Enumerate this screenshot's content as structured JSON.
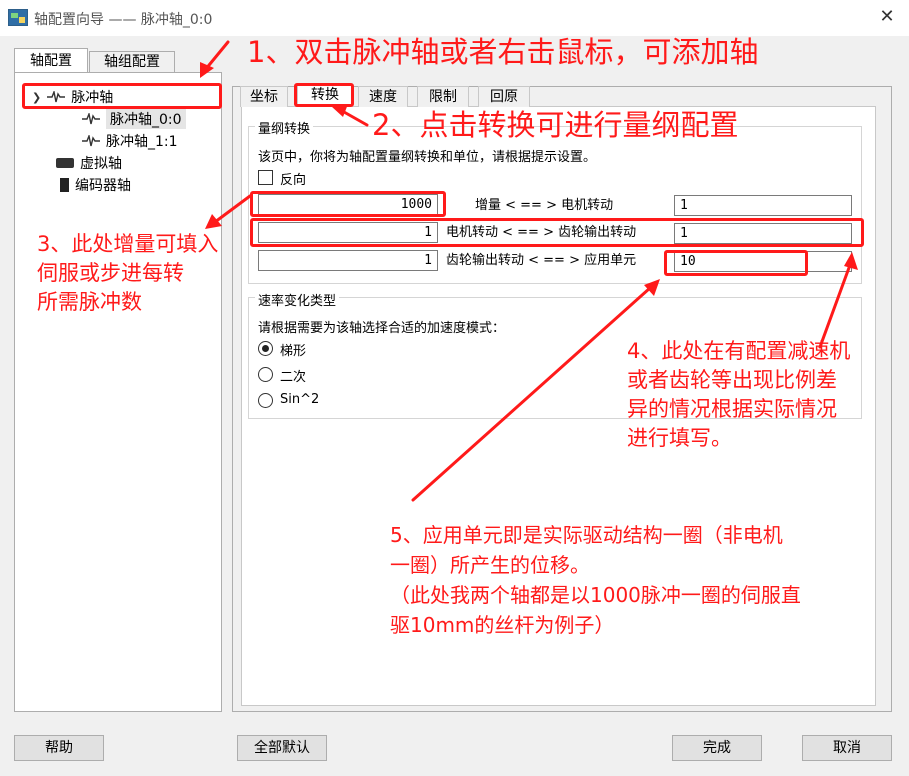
{
  "window": {
    "title": "轴配置向导 —— 脉冲轴_0:0",
    "close_glyph": "✕"
  },
  "top_tabs": [
    {
      "label": "轴配置",
      "active": true
    },
    {
      "label": "轴组配置",
      "active": false
    }
  ],
  "tree": {
    "root": {
      "label": "脉冲轴",
      "expanded": true
    },
    "children": [
      {
        "label": "脉冲轴_0:0",
        "selected": true
      },
      {
        "label": "脉冲轴_1:1",
        "selected": false
      }
    ],
    "others": [
      {
        "label": "虚拟轴",
        "icon": "virtual-axis-icon"
      },
      {
        "label": "编码器轴",
        "icon": "encoder-axis-icon"
      }
    ]
  },
  "inner_tabs": [
    {
      "label": "坐标",
      "active": false
    },
    {
      "label": "转换",
      "active": true
    },
    {
      "label": "速度",
      "active": false
    },
    {
      "label": "限制",
      "active": false
    },
    {
      "label": "回原",
      "active": false
    }
  ],
  "scaling": {
    "group_title": "量纲转换",
    "description": "该页中，你将为轴配置量纲转换和单位，请根据提示设置。",
    "reverse_label": "反向",
    "reverse_checked": false,
    "rows": [
      {
        "left_value": "1000",
        "label": "增量 < == > 电机转动",
        "right_value": "1"
      },
      {
        "left_value": "1",
        "label": "电机转动 < == > 齿轮输出转动",
        "right_value": "1"
      },
      {
        "left_value": "1",
        "label": "齿轮输出转动 < == > 应用单元",
        "right_value": "10"
      }
    ]
  },
  "ramp": {
    "group_title": "速率变化类型",
    "description": "请根据需要为该轴选择合适的加速度模式：",
    "options": [
      {
        "label": "梯形",
        "checked": true
      },
      {
        "label": "二次",
        "checked": false
      },
      {
        "label": "Sin^2",
        "checked": false
      }
    ]
  },
  "buttons": {
    "help": "帮助",
    "defaults": "全部默认",
    "finish": "完成",
    "cancel": "取消"
  },
  "annotations": {
    "a1": "1、双击脉冲轴或者右击鼠标，可添加轴",
    "a2": "2、点击转换可进行量纲配置",
    "a3": [
      "3、此处增量可填入",
      "伺服或步进每转",
      "所需脉冲数"
    ],
    "a4": [
      "4、此处在有配置减速机",
      "或者齿轮等出现比例差",
      "异的情况根据实际情况",
      "进行填写。"
    ],
    "a5": [
      "5、应用单元即是实际驱动结构一圈（非电机",
      "一圈）所产生的位移。",
      "（此处我两个轴都是以1000脉冲一圈的伺服直",
      "驱10mm的丝杆为例子）"
    ],
    "color": "#ff1a1a"
  }
}
